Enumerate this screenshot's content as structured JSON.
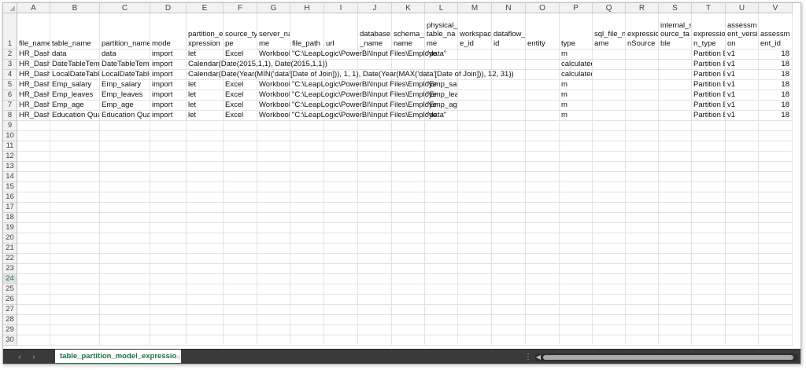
{
  "colors": {
    "accent": "#1e6f3f",
    "tabbar": "#3a3a3a",
    "header_bg": "#f2f2f2"
  },
  "selected_row": "24",
  "columns": [
    "A",
    "B",
    "C",
    "D",
    "E",
    "F",
    "G",
    "H",
    "I",
    "J",
    "K",
    "L",
    "M",
    "N",
    "O",
    "P",
    "Q",
    "R",
    "S",
    "T",
    "U",
    "V"
  ],
  "header_row": [
    "file_name",
    "table_name",
    "partition_name",
    "mode",
    "partition_e xpression",
    "source_ty pe",
    "server_na me",
    "file_path",
    "url",
    "database _name",
    "schema_ name",
    "physical_ table_na me",
    "workspac e_id",
    "dataflow_ id",
    "entity",
    "type",
    "sql_file_n ame",
    "expressio nSource",
    "internal_s ource_ta ble",
    "expressio n_type",
    "assessm ent_versi on",
    "assessm ent_id"
  ],
  "data_rows": [
    [
      "HR_Dashb",
      "data",
      "data",
      "import",
      "let",
      "Excel",
      "Workbook",
      "\"C:\\LeapLogic\\PowerBI\\Input Files\\Employe",
      "",
      "",
      "",
      "\"data\"",
      "",
      "",
      "",
      "m",
      "",
      "",
      "",
      "Partition E",
      "v1",
      "18"
    ],
    [
      "HR_Dashb",
      "DateTableTemp",
      "DateTableTempl",
      "import",
      "Calendar(Date(2015,1,1), Date(2015,1,1))",
      "",
      "",
      "",
      "",
      "",
      "",
      "",
      "",
      "",
      "",
      "calculated",
      "",
      "",
      "",
      "Partition E",
      "v1",
      "18"
    ],
    [
      "HR_Dashb",
      "LocalDateTable",
      "LocalDateTable_",
      "import",
      "Calendar(Date(Year(MIN('data'[Date of Join])), 1, 1), Date(Year(MAX('data'[Date of Join])), 12, 31))",
      "",
      "",
      "",
      "",
      "",
      "",
      "",
      "",
      "",
      "",
      "calculated",
      "",
      "",
      "",
      "Partition E",
      "v1",
      "18"
    ],
    [
      "HR_Dashb",
      "Emp_salary",
      "Emp_salary",
      "import",
      "let",
      "Excel",
      "Workbook",
      "\"C:\\LeapLogic\\PowerBI\\Input Files\\Employe",
      "",
      "",
      "",
      "\"Emp_salary\"",
      "",
      "",
      "",
      "m",
      "",
      "",
      "",
      "Partition E",
      "v1",
      "18"
    ],
    [
      "HR_Dashb",
      "Emp_leaves",
      "Emp_leaves",
      "import",
      "let",
      "Excel",
      "Workbook",
      "\"C:\\LeapLogic\\PowerBI\\Input Files\\Employe",
      "",
      "",
      "",
      "\"Emp_leaves\"",
      "",
      "",
      "",
      "m",
      "",
      "",
      "",
      "Partition E",
      "v1",
      "18"
    ],
    [
      "HR_Dashb",
      "Emp_age",
      "Emp_age",
      "import",
      "let",
      "Excel",
      "Workbook",
      "\"C:\\LeapLogic\\PowerBI\\Input Files\\Employe",
      "",
      "",
      "",
      "\"Emp_age\"",
      "",
      "",
      "",
      "m",
      "",
      "",
      "",
      "Partition E",
      "v1",
      "18"
    ],
    [
      "HR_Dashb",
      "Education Qual",
      "Education Qual",
      "import",
      "let",
      "Excel",
      "Workbook",
      "\"C:\\LeapLogic\\PowerBI\\Input Files\\Employe",
      "",
      "",
      "",
      "\"data\"",
      "",
      "",
      "",
      "m",
      "",
      "",
      "",
      "Partition E",
      "v1",
      "18"
    ]
  ],
  "row_numbers": [
    "1",
    "2",
    "3",
    "4",
    "5",
    "6",
    "7",
    "8",
    "9",
    "10",
    "11",
    "12",
    "13",
    "14",
    "15",
    "16",
    "17",
    "18",
    "19",
    "20",
    "21",
    "22",
    "23",
    "24",
    "25",
    "26",
    "27",
    "28",
    "29",
    "30"
  ],
  "tabbar": {
    "prev_icon": "chevron-left-icon",
    "next_icon": "chevron-right-icon",
    "sheet_tab": "table_partition_model_expressio",
    "add_sheet": "+",
    "menu": "⋮"
  }
}
